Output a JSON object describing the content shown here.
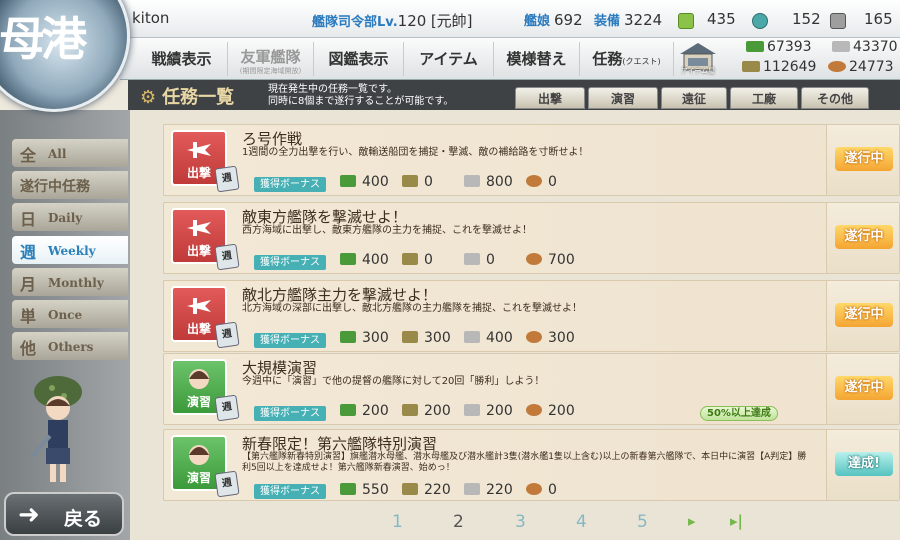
{
  "header": {
    "username": "kiton",
    "hq_label": "艦隊司令部",
    "level_label": "Lv.",
    "level": "120",
    "rank": "[元帥]",
    "ships_label": "艦娘",
    "ships": "692",
    "equip_label": "装備",
    "equip": "3224",
    "buckets": "435",
    "dev_materials": "152",
    "screws": "165",
    "emblem_text": "母港",
    "menu": {
      "record": "戦績表示",
      "allied": "友軍艦隊",
      "allied_sub": "(期間限定海域開放)",
      "library": "図鑑表示",
      "items": "アイテム",
      "furniture": "模様替え",
      "quest": "任務",
      "quest_sub": "(クエスト)",
      "shop_label": "アイテム屋"
    },
    "resources": {
      "fuel": "67393",
      "ammo": "112649",
      "steel": "43370",
      "bauxite": "24773"
    }
  },
  "title_bar": {
    "title": "任務一覧",
    "desc_line1": "現在発生中の任務一覧です。",
    "desc_line2": "同時に8個まで遂行することが可能です。",
    "tabs": [
      "出撃",
      "演習",
      "遠征",
      "工廠",
      "その他"
    ]
  },
  "categories": [
    {
      "kanji": "全",
      "label": "All"
    },
    {
      "kanji": "遂行中任務",
      "label": ""
    },
    {
      "kanji": "日",
      "label": "Daily"
    },
    {
      "kanji": "週",
      "label": "Weekly"
    },
    {
      "kanji": "月",
      "label": "Monthly"
    },
    {
      "kanji": "単",
      "label": "Once"
    },
    {
      "kanji": "他",
      "label": "Others"
    }
  ],
  "back_button": "戻る",
  "quests": [
    {
      "type_label": "出撃",
      "badge": "週",
      "name": "ろ号作戦",
      "desc": "1週間の全力出撃を行い、敵輸送船団を捕捉・撃滅、敵の補給路を寸断せよ！",
      "bonus": "獲得ボーナス",
      "fuel": "400",
      "ammo": "0",
      "steel": "800",
      "bauxite": "0",
      "status": "遂行中"
    },
    {
      "type_label": "出撃",
      "badge": "週",
      "name": "敵東方艦隊を撃滅せよ！",
      "desc": "西方海域に出撃し、敵東方艦隊の主力を捕捉、これを撃滅せよ！",
      "bonus": "獲得ボーナス",
      "fuel": "400",
      "ammo": "0",
      "steel": "0",
      "bauxite": "700",
      "status": "遂行中"
    },
    {
      "type_label": "出撃",
      "badge": "週",
      "name": "敵北方艦隊主力を撃滅せよ！",
      "desc": "北方海域の深部に出撃し、敵北方艦隊の主力艦隊を捕捉、これを撃滅せよ！",
      "bonus": "獲得ボーナス",
      "fuel": "300",
      "ammo": "300",
      "steel": "400",
      "bauxite": "300",
      "status": "遂行中"
    },
    {
      "type_label": "演習",
      "badge": "週",
      "name": "大規模演習",
      "desc": "今週中に「演習」で他の提督の艦隊に対して20回「勝利」しよう！",
      "bonus": "獲得ボーナス",
      "fuel": "200",
      "ammo": "200",
      "steel": "200",
      "bauxite": "200",
      "status": "遂行中",
      "progress": "50%以上達成"
    },
    {
      "type_label": "演習",
      "badge": "週",
      "name": "新春限定！第六艦隊特別演習",
      "desc": "【第六艦隊新春特別演習】旗艦潜水母艦、潜水母艦及び潜水艦計3隻(潜水艦1隻以上含む)以上の新春第六艦隊で、本日中に演習【A判定】勝利5回以上を達成せよ！第六艦隊新春演習、始めっ！",
      "bonus": "獲得ボーナス",
      "fuel": "550",
      "ammo": "220",
      "steel": "220",
      "bauxite": "0",
      "status": "達成!"
    }
  ],
  "pager": {
    "pages": [
      "1",
      "2",
      "3",
      "4",
      "5"
    ],
    "current": "2",
    "next": "▸",
    "last": "▸|"
  },
  "colors": {
    "sortie": "#d84a4a",
    "exercise": "#55b152",
    "accent": "#2a80b8",
    "bonus": "#46b0b4"
  }
}
